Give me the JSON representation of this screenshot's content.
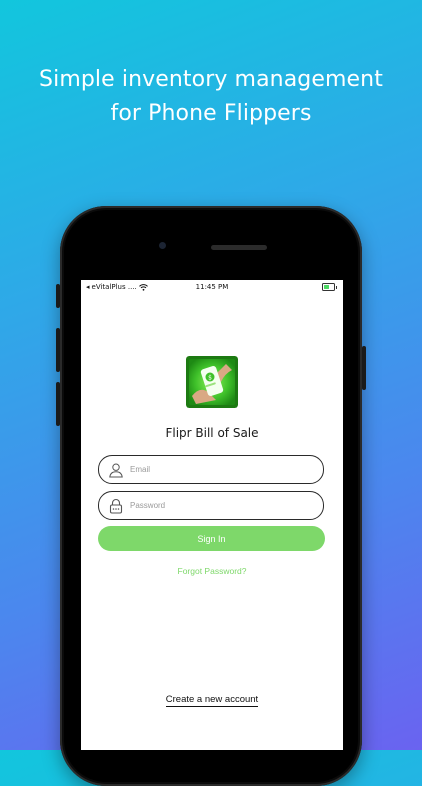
{
  "headline": {
    "line1": "Simple inventory management",
    "line2": "for Phone Flippers"
  },
  "status_bar": {
    "carrier": "eVitalPlus ....",
    "time": "11:45 PM",
    "battery_level": 0.6
  },
  "app": {
    "name": "Flipr Bill of Sale"
  },
  "login_form": {
    "email_placeholder": "Email",
    "password_placeholder": "Password",
    "sign_in_label": "Sign In",
    "forgot_label": "Forgot Password?",
    "create_account_label": "Create a new account"
  },
  "colors": {
    "accent_green": "#7ed86a",
    "gradient_top": "#12c6dd",
    "gradient_bottom": "#6a63f0"
  },
  "icons": {
    "back": "back-arrow-icon",
    "wifi": "wifi-icon",
    "battery": "battery-icon",
    "email_field": "user-icon",
    "password_field": "lock-icon"
  }
}
